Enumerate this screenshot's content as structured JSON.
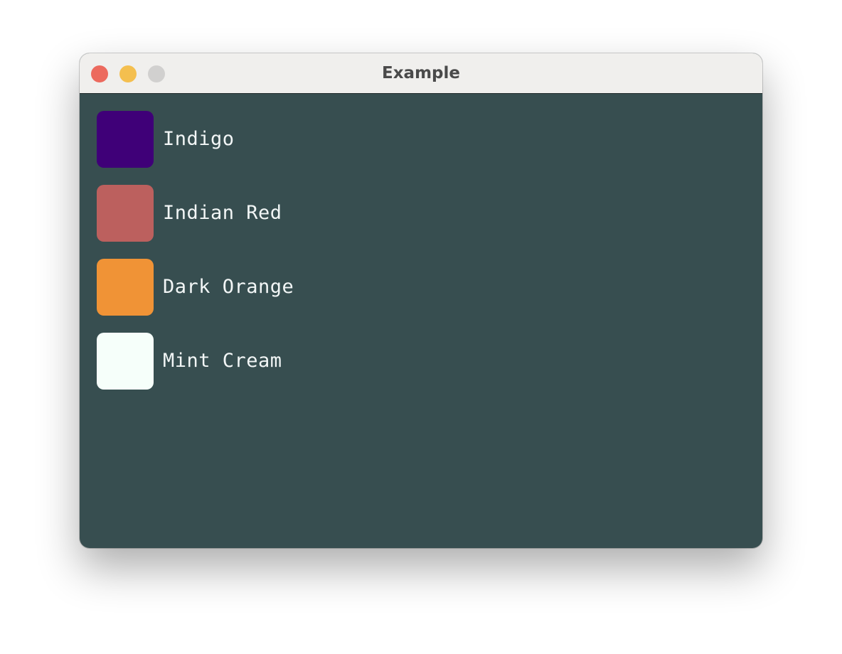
{
  "window": {
    "title": "Example",
    "background": "#374e50",
    "traffic_lights": {
      "close": "#ec6a5e",
      "minimize": "#f4bf4f",
      "zoom": "#d1d0cf"
    }
  },
  "colors": [
    {
      "label": "Indigo",
      "color": "#3f0078"
    },
    {
      "label": "Indian Red",
      "color": "#bc605e"
    },
    {
      "label": "Dark Orange",
      "color": "#f09336"
    },
    {
      "label": "Mint Cream",
      "color": "#f6fffa"
    }
  ]
}
